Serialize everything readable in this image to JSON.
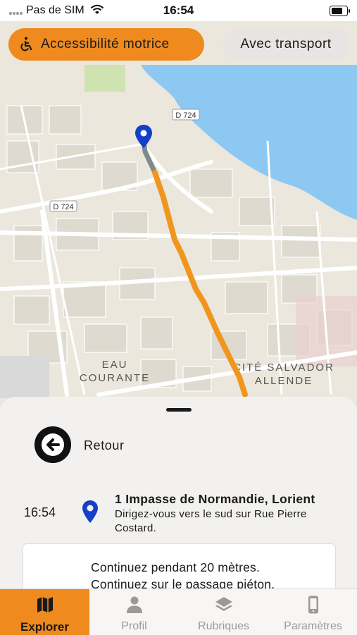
{
  "status_bar": {
    "carrier": "Pas de SIM",
    "time": "16:54"
  },
  "filters": {
    "accessibility_label": "Accessibilité motrice",
    "transport_label": "Avec transport"
  },
  "map": {
    "road_label_1": "D 724",
    "road_label_2": "D 724",
    "district_1_line1": "EAU",
    "district_1_line2": "COURANTE",
    "district_2_line1": "CITÉ SALVADOR",
    "district_2_line2": "ALLENDE",
    "colors": {
      "water": "#8cc8f2",
      "route": "#f0961e",
      "walked": "#7f8a8c",
      "pin": "#1440c8"
    }
  },
  "panel": {
    "back_label": "Retour",
    "step": {
      "time": "16:54",
      "title": "1 Impasse de Normandie, Lorient",
      "description": "Dirigez-vous vers le sud sur Rue Pierre Costard."
    },
    "card": {
      "line1": "Continuez pendant 20 mètres.",
      "line2": "Continuez sur le passage piéton."
    }
  },
  "tabs": [
    {
      "label": "Explorer",
      "icon": "map-icon",
      "active": true
    },
    {
      "label": "Profil",
      "icon": "person-icon",
      "active": false
    },
    {
      "label": "Rubriques",
      "icon": "layers-icon",
      "active": false
    },
    {
      "label": "Paramètres",
      "icon": "phone-icon",
      "active": false
    }
  ],
  "accent_color": "#ee8a1e"
}
